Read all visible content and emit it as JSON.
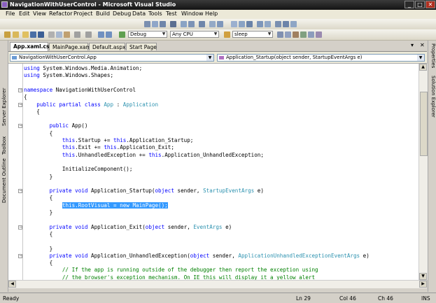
{
  "window": {
    "title": "NavigationWithUserControl - Microsoft Visual Studio",
    "minimize": "_",
    "maximize": "□",
    "close": "✕"
  },
  "menu": [
    "File",
    "Edit",
    "View",
    "Refactor",
    "Project",
    "Build",
    "Debug",
    "Data",
    "Tools",
    "Test",
    "Window",
    "Help"
  ],
  "toolbar": {
    "configuration": "Debug",
    "platform": "Any CPU",
    "find": "sleep"
  },
  "tabs": [
    "App.xaml.cs",
    "MainPage.xaml",
    "Default.aspx",
    "Start Page"
  ],
  "nav": {
    "type_combo": "NavigationWithUserControl.App",
    "member_combo": "Application_Startup(object sender, StartupEventArgs e)"
  },
  "left_panels": [
    "Server Explorer",
    "Toolbox",
    "Document Outline"
  ],
  "right_panels": [
    "Properties",
    "Solution Explorer"
  ],
  "code_lines": [
    "using System.Windows.Media.Animation;",
    "using System.Windows.Shapes;",
    "",
    "namespace NavigationWithUserControl",
    "{",
    "    public partial class App : Application",
    "    {",
    "",
    "        public App()",
    "        {",
    "            this.Startup += this.Application_Startup;",
    "            this.Exit += this.Application_Exit;",
    "            this.UnhandledException += this.Application_UnhandledException;",
    "",
    "            InitializeComponent();",
    "        }",
    "",
    "        private void Application_Startup(object sender, StartupEventArgs e)",
    "        {",
    "            this.RootVisual = new MainPage();",
    "        }",
    "",
    "        private void Application_Exit(object sender, EventArgs e)",
    "        {",
    "",
    "        }",
    "        private void Application_UnhandledException(object sender, ApplicationUnhandledExceptionEventArgs e)",
    "        {",
    "            // If the app is running outside of the debugger then report the exception using",
    "            // the browser's exception mechanism. On IE this will display it a yellow alert"
  ],
  "status": {
    "ready": "Ready",
    "line": "Ln 29",
    "col": "Col 46",
    "ch": "Ch 46",
    "mode": "INS"
  },
  "colors": {
    "keyword": "#0000ff",
    "type": "#2b91af",
    "comment": "#008000",
    "selection": "#3399ff"
  }
}
